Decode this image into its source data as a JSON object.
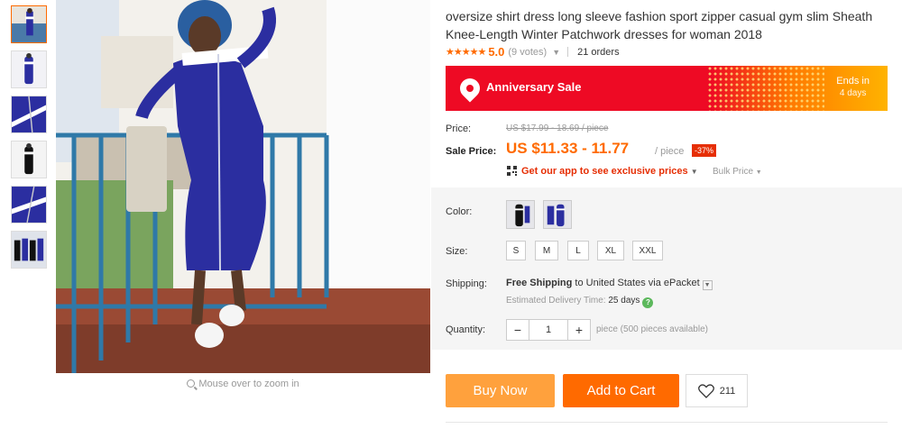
{
  "thumbnails": [
    {
      "name": "thumb-1",
      "active": true
    },
    {
      "name": "thumb-2",
      "active": false
    },
    {
      "name": "thumb-3",
      "active": false
    },
    {
      "name": "thumb-4",
      "active": false
    },
    {
      "name": "thumb-5",
      "active": false
    },
    {
      "name": "thumb-6",
      "active": false
    }
  ],
  "gallery": {
    "zoom_hint": "Mouse over to zoom in"
  },
  "product": {
    "title": "oversize shirt dress long sleeve fashion sport zipper casual gym slim Sheath Knee-Length Winter Patchwork dresses for woman 2018",
    "stars": "★★★★★",
    "rating": "5.0",
    "votes": "(9 votes)",
    "orders": "21 orders"
  },
  "banner": {
    "title": "Anniversary Sale",
    "ends_label": "Ends in",
    "ends_days": "4 days",
    "colors": {
      "red": "#ee0a24",
      "orange": "#ff7a00",
      "yellow": "#ffb300"
    }
  },
  "price": {
    "label": "Price:",
    "original": "US $17.99 - 18.69 / piece",
    "sale_label": "Sale Price:",
    "sale": "US $11.33 - 11.77",
    "per_piece": "/ piece",
    "discount": "-37%",
    "app_promo": "Get our app to see exclusive prices",
    "bulk": "Bulk Price"
  },
  "options": {
    "color_label": "Color:",
    "colors": [
      "blue-white-dress",
      "blue-white-dress-alt"
    ],
    "size_label": "Size:",
    "sizes": [
      "S",
      "M",
      "L",
      "XL",
      "XXL"
    ],
    "shipping_label": "Shipping:",
    "shipping_free": "Free Shipping",
    "shipping_to": "to",
    "shipping_country": "United States",
    "shipping_via": "via ePacket",
    "delivery_label": "Estimated Delivery Time:",
    "delivery_days": "25 days",
    "quantity_label": "Quantity:",
    "quantity": "1",
    "availability": "piece (500 pieces available)"
  },
  "actions": {
    "buy_now": "Buy Now",
    "add_to_cart": "Add to Cart",
    "wishlist_count": "211",
    "buy_color": "#ffa13d",
    "cart_color": "#ff6a00"
  }
}
